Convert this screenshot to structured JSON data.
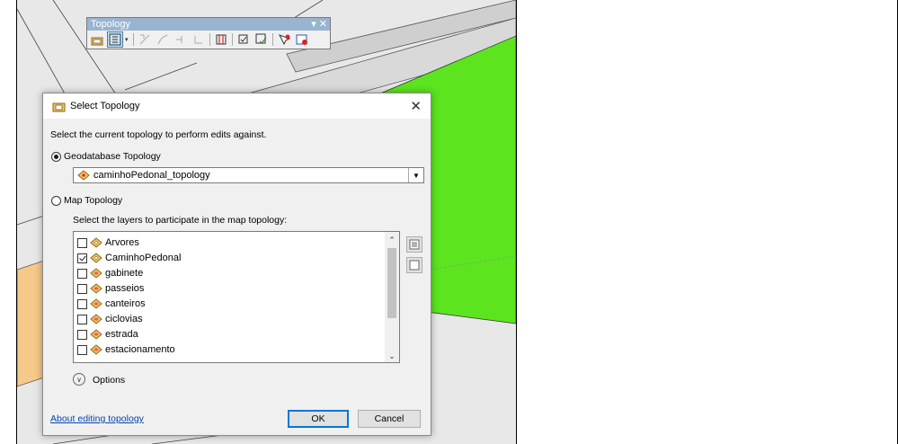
{
  "toolbar": {
    "title": "Topology",
    "controls": "▾ ✕"
  },
  "dialog": {
    "title": "Select Topology",
    "close_glyph": "✕",
    "instruction": "Select the current topology to perform edits against.",
    "geodatabase_option": "Geodatabase Topology",
    "geodatabase_selected": true,
    "topology_value": "caminhoPedonal_topology",
    "map_option": "Map Topology",
    "layers_instruction": "Select the layers to participate in the map topology:",
    "layers": [
      {
        "name": "Arvores",
        "checked": false,
        "icon": "point-layer-icon"
      },
      {
        "name": "CaminhoPedonal",
        "checked": true,
        "icon": "point-layer-icon"
      },
      {
        "name": "gabinete",
        "checked": false,
        "icon": "polygon-layer-icon"
      },
      {
        "name": "passeios",
        "checked": false,
        "icon": "polygon-layer-icon"
      },
      {
        "name": "canteiros",
        "checked": false,
        "icon": "polygon-layer-icon"
      },
      {
        "name": "ciclovias",
        "checked": false,
        "icon": "polygon-layer-icon"
      },
      {
        "name": "estrada",
        "checked": false,
        "icon": "polygon-layer-icon"
      },
      {
        "name": "estacionamento",
        "checked": false,
        "icon": "polygon-layer-icon"
      }
    ],
    "options_label": "Options",
    "help_link": "About editing topology",
    "ok_label": "OK",
    "cancel_label": "Cancel"
  },
  "colors": {
    "map_green": "#5ce51e",
    "map_gray": "#e8e8e8",
    "map_orange": "#f5c98a",
    "link_blue": "#0645ad",
    "accent": "#0078d7"
  }
}
